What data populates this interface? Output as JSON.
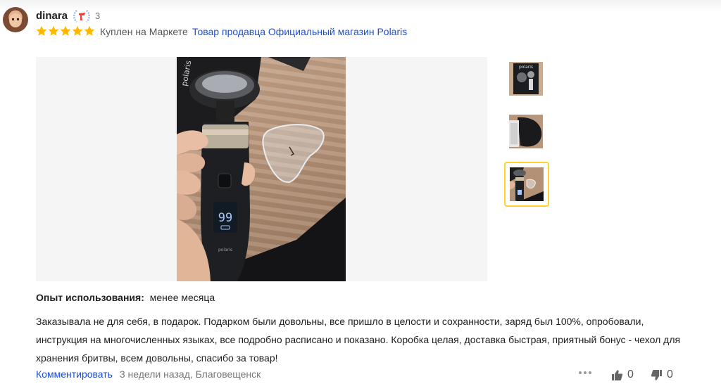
{
  "review": {
    "author": "dinara",
    "badge_count": "3",
    "rating": 5,
    "bought_label": "Куплен на Маркете",
    "seller_link": "Товар продавца Официальный магазин Polaris",
    "photos": [
      {
        "name": "thumb-box-photo",
        "active": false
      },
      {
        "name": "thumb-case-photo",
        "active": false
      },
      {
        "name": "thumb-shaver-photo",
        "active": true
      }
    ],
    "experience_label": "Опыт использования:",
    "experience_value": "менее месяца",
    "text": "Заказывала не для себя, в подарок. Подарком были довольны, все пришло в целости и сохранности, заряд был 100%, опробовали, инструкция на многочисленных языках, все подробно расписано и показано. Коробка целая, доставка быстрая, приятный бонус - чехол для хранения бритвы, всем довольны, спасибо за товар!",
    "comment_label": "Комментировать",
    "meta": "3 недели назад, Благовещенск",
    "likes": "0",
    "dislikes": "0",
    "shaver_display": "99"
  },
  "colors": {
    "star": "#ffb800",
    "link": "#1a4fd6",
    "active_thumb_border": "#fed42b"
  }
}
